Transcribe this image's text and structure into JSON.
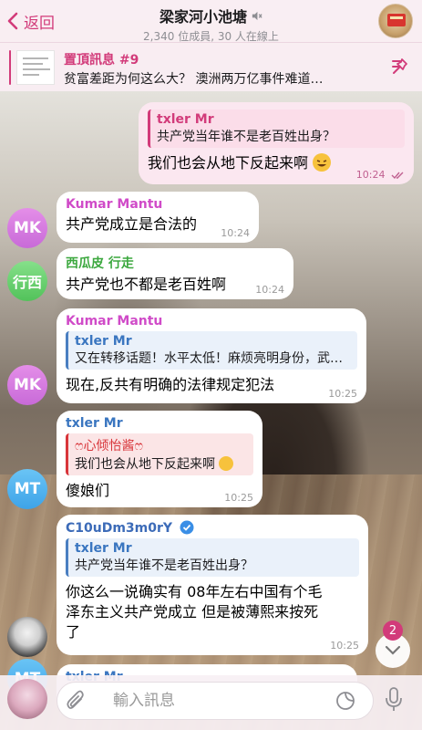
{
  "header": {
    "back_label": "返回",
    "title": "梁家河小池塘",
    "subtitle": "2,340 位成員, 30 人在線上"
  },
  "pinned": {
    "label": "置頂訊息 #9",
    "text": "贫富差距为何这么大？ 澳洲两万亿事件难道…"
  },
  "messages": {
    "m1": {
      "quote_name": "txler Mr",
      "quote_text": "共产党当年谁不是老百姓出身？",
      "text": "我们也会从地下反起来啊",
      "time": "10:24"
    },
    "m2": {
      "sender": "Kumar Mantu",
      "text": "共产党成立是合法的",
      "time": "10:24",
      "avatar": "MK"
    },
    "m3": {
      "sender": "西瓜皮 行走",
      "text": "共产党也不都是老百姓啊",
      "time": "10:24",
      "avatar": "行西"
    },
    "m4": {
      "sender": "Kumar Mantu",
      "quote_name": "txler Mr",
      "quote_text": "又在转移话题！水平太低！麻烦亮明身份，武…",
      "text": "现在,反共有明确的法律规定犯法",
      "time": "10:25",
      "avatar": "MK"
    },
    "m5": {
      "sender": "txler Mr",
      "quote_name": "ෆ心倾怡酱ෆ",
      "quote_text": "我们也会从地下反起来啊",
      "text": "傻娘们",
      "time": "10:25",
      "avatar": "MT"
    },
    "m6": {
      "sender": "C10uDm3m0rY",
      "quote_name": "txler Mr",
      "quote_text": "共产党当年谁不是老百姓出身？",
      "text_line1": "你这么一说确实有 08年左右中国有个毛",
      "text_line2": "泽东主义共产党成立 但是被薄熙来按死",
      "text_line3": "了",
      "time": "10:25"
    },
    "m7": {
      "sender": "txler Mr",
      "avatar": "MT"
    }
  },
  "scroll": {
    "unread_count": "2"
  },
  "composer": {
    "placeholder": "輸入訊息"
  },
  "colors": {
    "accent": "#d23b7a",
    "header_bg": "#faeef4",
    "outgoing_bubble": "#fbe7f0",
    "link_blue": "#3a76c0"
  }
}
